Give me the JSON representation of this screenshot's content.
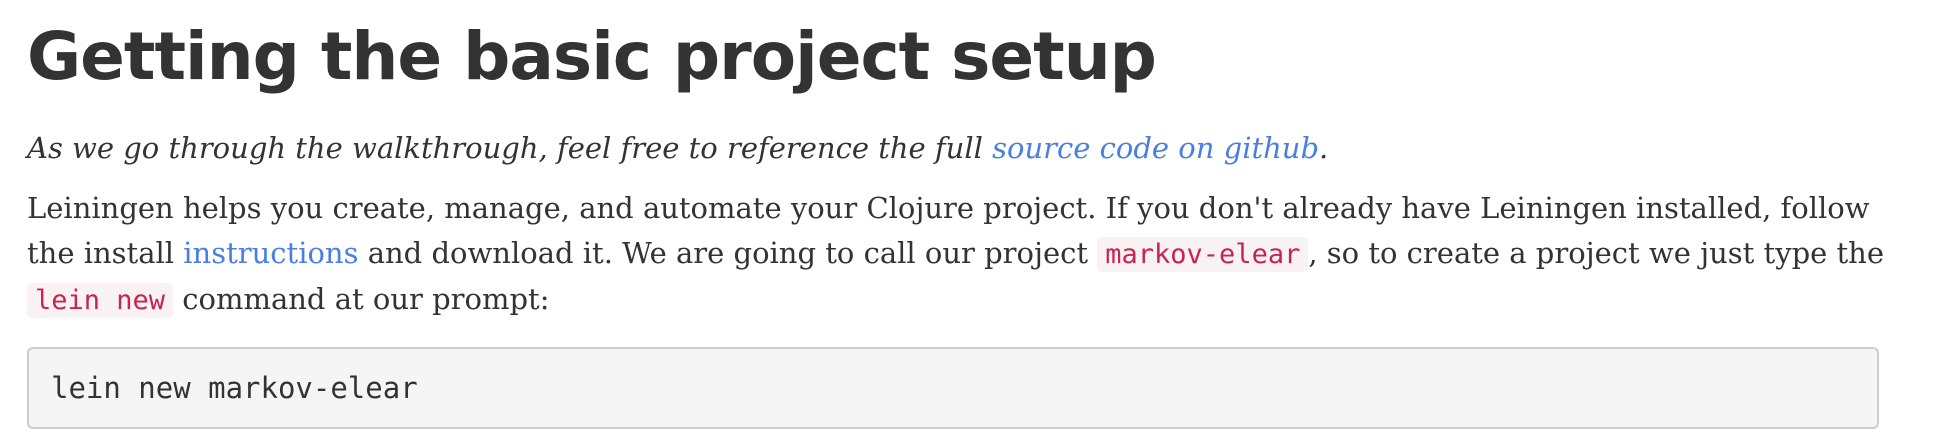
{
  "heading": "Getting the basic project setup",
  "intro": {
    "prefix": "As we go through the walkthrough, feel free to reference the full ",
    "link_text": "source code on github",
    "suffix": "."
  },
  "paragraph": {
    "part1": "Leiningen helps you create, manage, and automate your Clojure project. If you don't already have Leiningen installed, follow the install ",
    "link_text": "instructions",
    "part2": " and download it. We are going to call our project ",
    "code1": "markov-elear",
    "part3": ", so to create a project we just type the ",
    "code2": "lein new",
    "part4": " command at our prompt:"
  },
  "code_block": "lein new markov-elear",
  "colors": {
    "text": "#333333",
    "link": "#4a7fe0",
    "inline_code": "#c7254e",
    "code_block_bg": "#f5f5f5"
  }
}
